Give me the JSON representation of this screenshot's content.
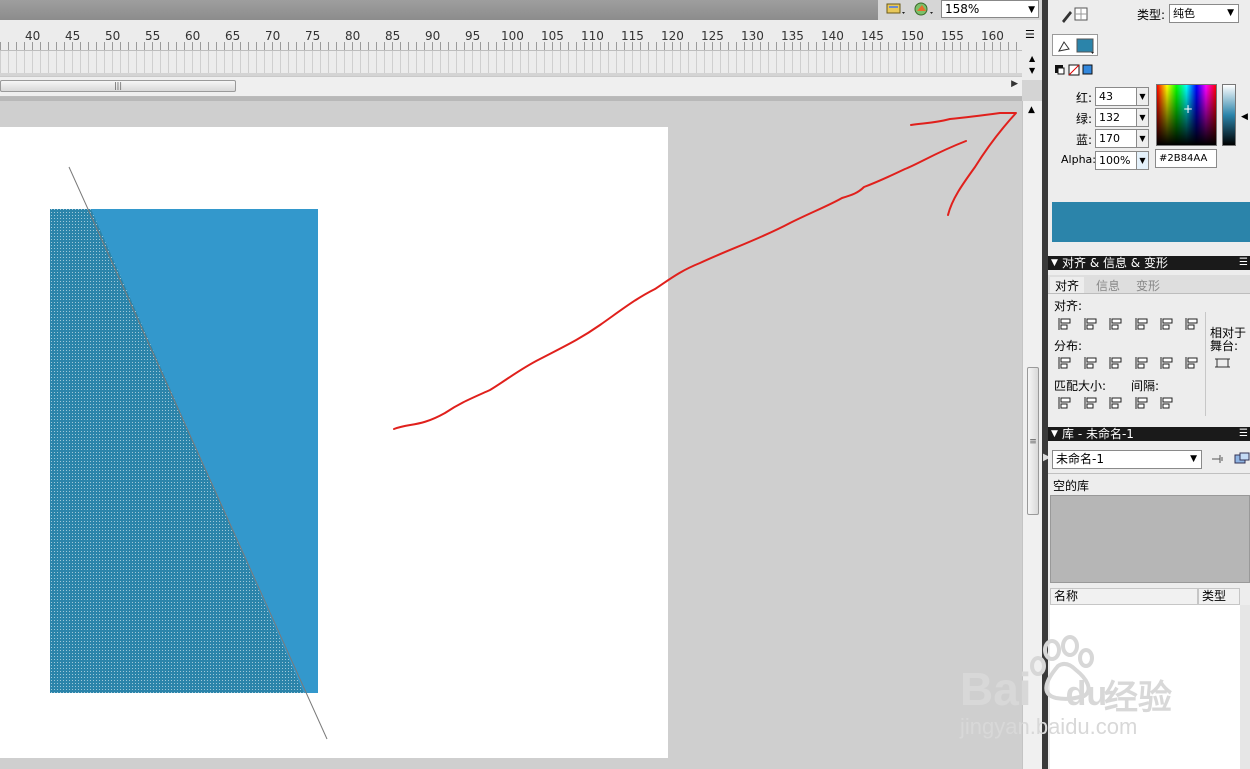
{
  "toolbar": {
    "zoom_value": "158%",
    "icons": [
      "edit-symbol-icon",
      "edit-scene-icon"
    ]
  },
  "ruler": {
    "ticks": [
      "40",
      "45",
      "50",
      "55",
      "60",
      "65",
      "70",
      "75",
      "80",
      "85",
      "90",
      "95",
      "100",
      "105",
      "110",
      "115",
      "120",
      "125",
      "130",
      "135",
      "140",
      "145",
      "150",
      "155",
      "160"
    ]
  },
  "color_panel": {
    "type_label": "类型:",
    "type_value": "纯色",
    "red_label": "红:",
    "red_value": "43",
    "green_label": "绿:",
    "green_value": "132",
    "blue_label": "蓝:",
    "blue_value": "170",
    "alpha_label": "Alpha:",
    "alpha_value": "100%",
    "hex_value": "#2B84AA",
    "fill_color": "#2B84AA"
  },
  "align_panel": {
    "header": "对齐 & 信息 & 变形",
    "tabs": [
      "对齐",
      "信息",
      "变形"
    ],
    "align_label": "对齐:",
    "distribute_label": "分布:",
    "match_size_label": "匹配大小:",
    "spacing_label": "间隔:",
    "relative_label_1": "相对于",
    "relative_label_2": "舞台:"
  },
  "library_panel": {
    "header": "库 - 未命名-1",
    "doc_select": "未命名-1",
    "empty_text": "空的库",
    "col_name": "名称",
    "col_type": "类型"
  },
  "stage": {
    "rect_color": "#3398CC",
    "hatch_color": "#2B84AA",
    "annotation_color": "#E0201C"
  },
  "watermark": {
    "brand": "Bai",
    "brand_tail": "du",
    "cn": "经验",
    "url": "jingyan.baidu.com"
  }
}
